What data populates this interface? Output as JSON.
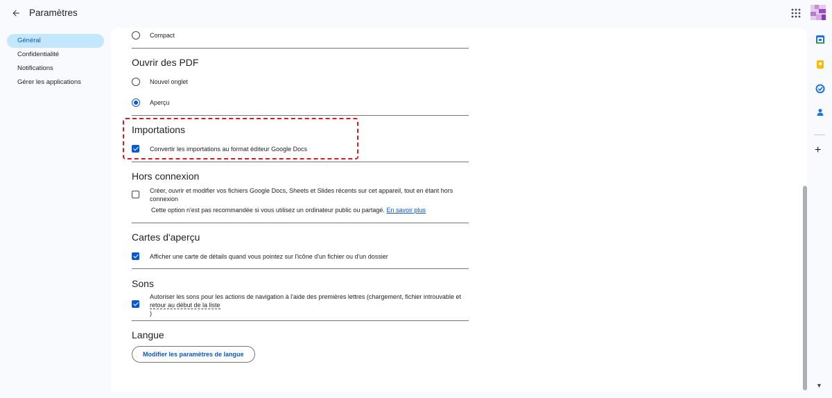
{
  "header": {
    "title": "Paramètres"
  },
  "nav": {
    "items": [
      {
        "label": "Général",
        "active": true
      },
      {
        "label": "Confidentialité",
        "active": false
      },
      {
        "label": "Notifications",
        "active": false
      },
      {
        "label": "Gérer les applications",
        "active": false
      }
    ]
  },
  "density": {
    "compact_label": "Compact"
  },
  "pdf": {
    "title": "Ouvrir des PDF",
    "new_tab_label": "Nouvel onglet",
    "preview_label": "Aperçu"
  },
  "imports": {
    "title": "Importations",
    "convert_label": "Convertir les importations au format éditeur Google Docs"
  },
  "offline": {
    "title": "Hors connexion",
    "label": "Créer, ouvrir et modifier vos fichiers Google Docs, Sheets et Slides récents sur cet appareil, tout en étant hors connexion",
    "note": "Cette option n'est pas recommandée si vous utilisez un ordinateur public ou partagé.",
    "link": "En savoir plus"
  },
  "preview_cards": {
    "title": "Cartes d'aperçu",
    "label": "Afficher une carte de détails quand vous pointez sur l'icône d'un fichier ou d'un dossier"
  },
  "sounds": {
    "title": "Sons",
    "label_part1": "Autoriser les sons pour les actions de navigation à l'aide des premières lettres (chargement, fichier introuvable et",
    "label_part2": "retour au début de la liste",
    "label_part3": ")"
  },
  "language": {
    "title": "Langue",
    "button": "Modifier les paramètres de langue"
  },
  "colors": {
    "accent": "#0b57d0",
    "active_nav_bg": "#c2e7ff",
    "highlight": "#d71920"
  }
}
